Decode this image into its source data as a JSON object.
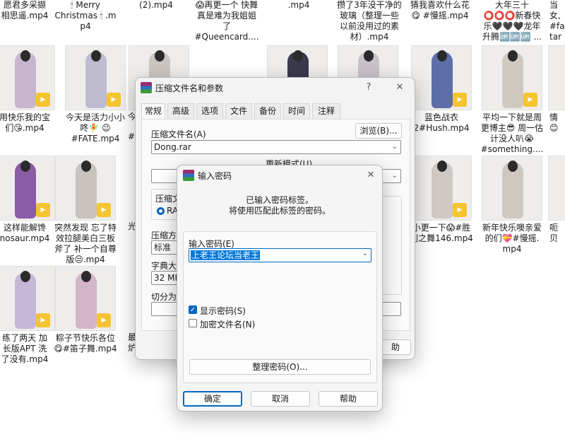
{
  "explorer": {
    "items": [
      {
        "name": "愿君多采撷\n相思遥.mp4",
        "accent": "#d7c4c1"
      },
      {
        "name": "🕯 Merry\nChristmas 🕯 .m\np4",
        "accent": "#cfc9c2"
      },
      {
        "name": "(2).mp4",
        "accent": "#d6d0c7"
      },
      {
        "name": "😱再更一个 快舞\n真是难为我姐姐\n了\n#Queencard....",
        "accent": "#c9c2bb"
      },
      {
        "name": ".mp4",
        "accent": "#d2cbc3"
      },
      {
        "name": "攒了3年没干净的\n玻璃（整理一些\n以前没用过的素\n材）.mp4",
        "accent": "#cac3bc"
      },
      {
        "name": "猜我喜欢什么花\n😋 #慢摇.mp4",
        "accent": "#d0c9c1"
      },
      {
        "name": "大年三十\n⭕⭕⭕新春快\n乐🖤🖤🖤龙年\n升腾🆙🆙🆙 ...",
        "accent": "#cdc6bf"
      },
      {
        "name": "当\n女,\n#fa\ntar",
        "accent": "#cbc4bd"
      },
      {
        "name": "用快乐我的宝\n们😘.mp4",
        "accent": "#c7b5d0"
      },
      {
        "name": "今天是活力小小\n咚🧚 😉\n#FATE.mp4",
        "accent": "#bfbcd1"
      },
      {
        "name": "",
        "accent": "#cbc6c0"
      },
      {
        "name": "",
        "accent": "#3a3a4e"
      },
      {
        "name": "",
        "accent": "#c9c2c9"
      },
      {
        "name": "",
        "accent": "#cac4c2"
      },
      {
        "name": "蓝色战衣\n2#Hush.mp4",
        "accent": "#5d6fa8"
      },
      {
        "name": "平均一下就是周\n更博主😎 周一估\n计没人叭😭\n#something....",
        "accent": "#cfc9c2"
      },
      {
        "name": "情\n😊",
        "accent": "#d4cec7"
      },
      {
        "name": "这样能解馋\nnosaur.mp4",
        "accent": "#8a5ba6"
      },
      {
        "name": "突然发现 忘了特\n效拉腿美白三板\n斧了 补一个自尊\n版😒.mp4",
        "accent": "#c8c3bd"
      },
      {
        "name": "",
        "accent": "#ccc6bf"
      },
      {
        "name": "",
        "accent": "#ccc6bf"
      },
      {
        "name": "",
        "accent": "#ccc6bf"
      },
      {
        "name": "",
        "accent": "#ccc6bf"
      },
      {
        "name": "小更一下😱#胜\n利之舞146.mp4",
        "accent": "#cfc9c3"
      },
      {
        "name": "新年快乐噢亲爱\n的们💝#慢摇.\nmp4",
        "accent": "#cfc8c1"
      },
      {
        "name": "呃\n贝",
        "accent": "#d3cdc6"
      },
      {
        "name": "练了两天 加\n长版APT 洗\n了没有.mp4",
        "accent": "#c5b7d6"
      },
      {
        "name": "粽子节快乐各位\n😋#笛子舞.mp4",
        "accent": "#d2b6c8"
      }
    ]
  },
  "archive_dialog": {
    "title": "压缩文件名和参数",
    "help_glyph": "?",
    "close_glyph": "✕",
    "tabs": [
      "常规",
      "高级",
      "选项",
      "文件",
      "备份",
      "时间",
      "注释"
    ],
    "archive_name_label": "压缩文件名(A)",
    "browse_label": "浏览(B)...",
    "archive_name_value": "Dong.rar",
    "update_mode_label": "更新模式(U)",
    "format_group_label": "压缩文",
    "format_rar": "RAR",
    "method_label": "压缩方式",
    "method_value": "标准",
    "dict_label": "字典大小",
    "dict_value": "32 MB",
    "split_label": "切分为分",
    "side_label_1": "今",
    "side_label_2": "#",
    "side_label_3": "光",
    "side_label_4": "最",
    "side_label_5": "炉",
    "help_partial": "助"
  },
  "password_dialog": {
    "title": "输入密码",
    "close_glyph": "✕",
    "message_line1": "已输入密码标签。",
    "message_line2": "将使用匹配此标签的密码。",
    "password_label": "输入密码(E)",
    "password_value": "上老王论坛当老王",
    "show_password_label": "显示密码(S)",
    "show_password_checked": true,
    "encrypt_names_label": "加密文件名(N)",
    "encrypt_names_checked": false,
    "organize_label": "整理密码(O)...",
    "ok_label": "确定",
    "cancel_label": "取消",
    "help_label": "帮助",
    "check_glyph": "✓"
  }
}
